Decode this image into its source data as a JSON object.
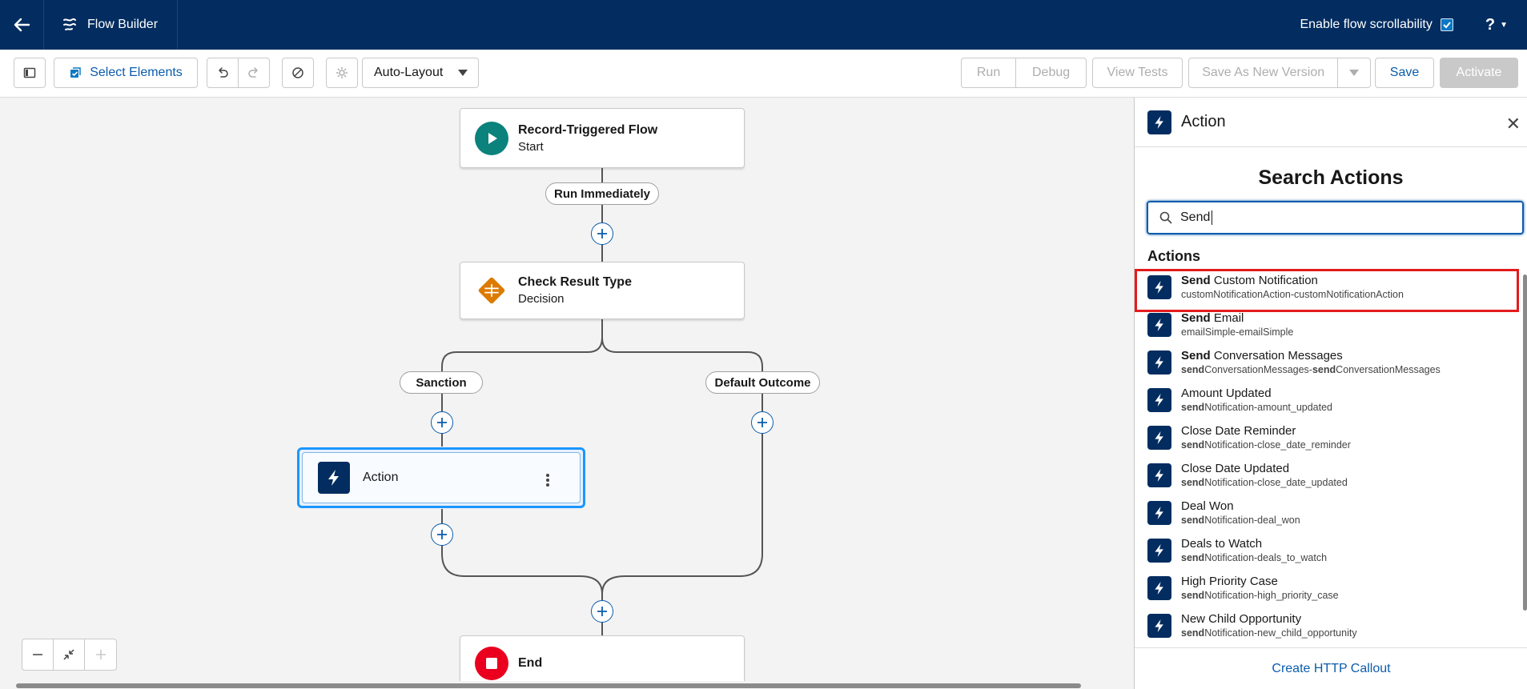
{
  "header": {
    "app_title": "Flow Builder",
    "scroll_label": "Enable flow scrollability",
    "scroll_checked": true,
    "help_label": "?"
  },
  "toolbar": {
    "select_elements": "Select Elements",
    "layout_mode": "Auto-Layout",
    "run": "Run",
    "debug": "Debug",
    "view_tests": "View Tests",
    "save_as_new": "Save As New Version",
    "save": "Save",
    "activate": "Activate"
  },
  "canvas": {
    "start_node": {
      "title": "Record-Triggered Flow",
      "subtitle": "Start"
    },
    "run_label": "Run Immediately",
    "decision_node": {
      "title": "Check Result Type",
      "subtitle": "Decision"
    },
    "outcome_left": "Sanction",
    "outcome_right": "Default Outcome",
    "action_node": {
      "label": "Action"
    },
    "end_node": {
      "title": "End"
    }
  },
  "panel": {
    "title": "Action",
    "heading": "Search Actions",
    "search_value": "Send",
    "section": "Actions",
    "items": [
      {
        "bold": "Send",
        "title": " Custom Notification",
        "sub_bold": "",
        "sub": "customNotificationAction-customNotificationAction"
      },
      {
        "bold": "Send",
        "title": " Email",
        "sub_bold": "",
        "sub": "emailSimple-emailSimple"
      },
      {
        "bold": "Send",
        "title": " Conversation Messages",
        "sub_bold": "send",
        "sub": "ConversationMessages-",
        "sub_bold2": "send",
        "sub2": "ConversationMessages"
      },
      {
        "bold": "",
        "title": "Amount Updated",
        "sub_bold": "send",
        "sub": "Notification-amount_updated"
      },
      {
        "bold": "",
        "title": "Close Date Reminder",
        "sub_bold": "send",
        "sub": "Notification-close_date_reminder"
      },
      {
        "bold": "",
        "title": "Close Date Updated",
        "sub_bold": "send",
        "sub": "Notification-close_date_updated"
      },
      {
        "bold": "",
        "title": "Deal Won",
        "sub_bold": "send",
        "sub": "Notification-deal_won"
      },
      {
        "bold": "",
        "title": "Deals to Watch",
        "sub_bold": "send",
        "sub": "Notification-deals_to_watch"
      },
      {
        "bold": "",
        "title": "High Priority Case",
        "sub_bold": "send",
        "sub": "Notification-high_priority_case"
      },
      {
        "bold": "",
        "title": "New Child Opportunity",
        "sub_bold": "send",
        "sub": "Notification-new_child_opportunity"
      }
    ],
    "footer_link": "Create HTTP Callout"
  },
  "colors": {
    "header_bg": "#032d60",
    "brand_blue": "#0b5cab",
    "highlight_red": "#e31c1c",
    "start_green": "#0b827c",
    "decision_orange": "#dd7a01",
    "end_red": "#ea001e"
  }
}
